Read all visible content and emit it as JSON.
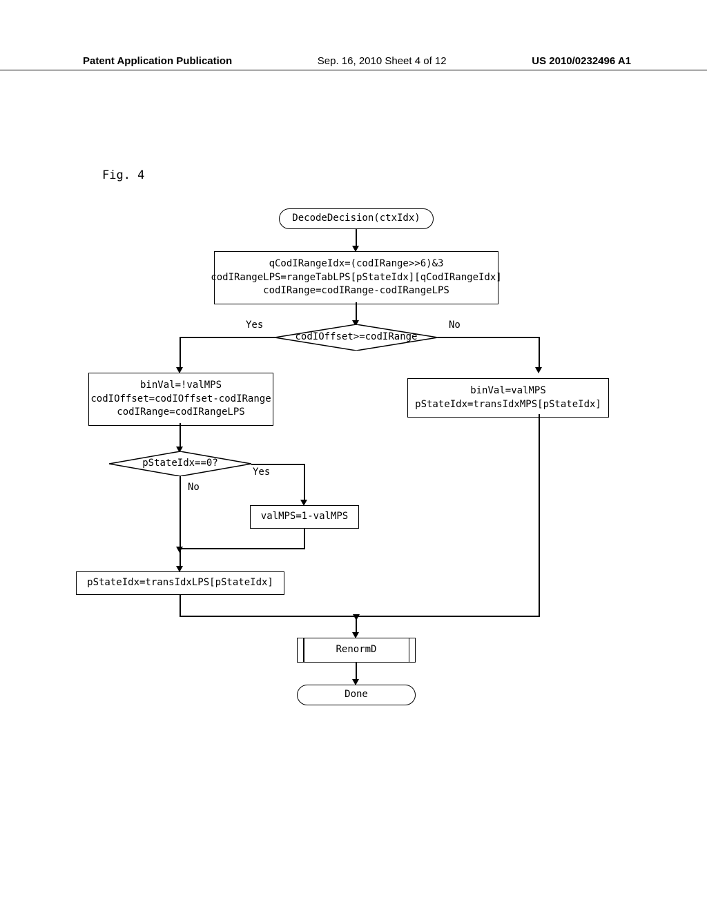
{
  "header": {
    "left": "Patent Application Publication",
    "mid": "Sep. 16, 2010  Sheet 4 of 12",
    "right": "US 2010/0232496 A1"
  },
  "figlabel": "Fig. 4",
  "nodes": {
    "start": "DecodeDecision(ctxIdx)",
    "init": "qCodIRangeIdx=(codIRange>>6)&3\ncodIRangeLPS=rangeTabLPS[pStateIdx][qCodIRangeIdx]\ncodIRange=codIRange-codIRangeLPS",
    "d1": "codIOffset>=codIRange",
    "d1_yes": "Yes",
    "d1_no": "No",
    "lps": "binVal=!valMPS\ncodIOffset=codIOffset-codIRange\ncodIRange=codIRangeLPS",
    "mps": "binVal=valMPS\npStateIdx=transIdxMPS[pStateIdx]",
    "d2": "pStateIdx==0?",
    "d2_yes": "Yes",
    "d2_no": "No",
    "flip": "valMPS=1-valMPS",
    "translps": "pStateIdx=transIdxLPS[pStateIdx]",
    "renorm": "RenormD",
    "done": "Done"
  },
  "chart_data": {
    "type": "flowchart",
    "title": "Fig. 4 — DecodeDecision(ctxIdx) CABAC arithmetic-decode decision routine",
    "nodes": [
      {
        "id": "start",
        "kind": "terminal",
        "text": "DecodeDecision(ctxIdx)"
      },
      {
        "id": "init",
        "kind": "process",
        "text": "qCodIRangeIdx=(codIRange>>6)&3; codIRangeLPS=rangeTabLPS[pStateIdx][qCodIRangeIdx]; codIRange=codIRange-codIRangeLPS"
      },
      {
        "id": "d1",
        "kind": "decision",
        "text": "codIOffset>=codIRange"
      },
      {
        "id": "lps",
        "kind": "process",
        "text": "binVal=!valMPS; codIOffset=codIOffset-codIRange; codIRange=codIRangeLPS"
      },
      {
        "id": "mps",
        "kind": "process",
        "text": "binVal=valMPS; pStateIdx=transIdxMPS[pStateIdx]"
      },
      {
        "id": "d2",
        "kind": "decision",
        "text": "pStateIdx==0?"
      },
      {
        "id": "flip",
        "kind": "process",
        "text": "valMPS=1-valMPS"
      },
      {
        "id": "translps",
        "kind": "process",
        "text": "pStateIdx=transIdxLPS[pStateIdx]"
      },
      {
        "id": "renorm",
        "kind": "subroutine",
        "text": "RenormD"
      },
      {
        "id": "done",
        "kind": "terminal",
        "text": "Done"
      }
    ],
    "edges": [
      {
        "from": "start",
        "to": "init"
      },
      {
        "from": "init",
        "to": "d1"
      },
      {
        "from": "d1",
        "to": "lps",
        "label": "Yes"
      },
      {
        "from": "d1",
        "to": "mps",
        "label": "No"
      },
      {
        "from": "lps",
        "to": "d2"
      },
      {
        "from": "d2",
        "to": "flip",
        "label": "Yes"
      },
      {
        "from": "d2",
        "to": "translps",
        "label": "No"
      },
      {
        "from": "flip",
        "to": "translps"
      },
      {
        "from": "translps",
        "to": "renorm"
      },
      {
        "from": "mps",
        "to": "renorm"
      },
      {
        "from": "renorm",
        "to": "done"
      }
    ]
  }
}
